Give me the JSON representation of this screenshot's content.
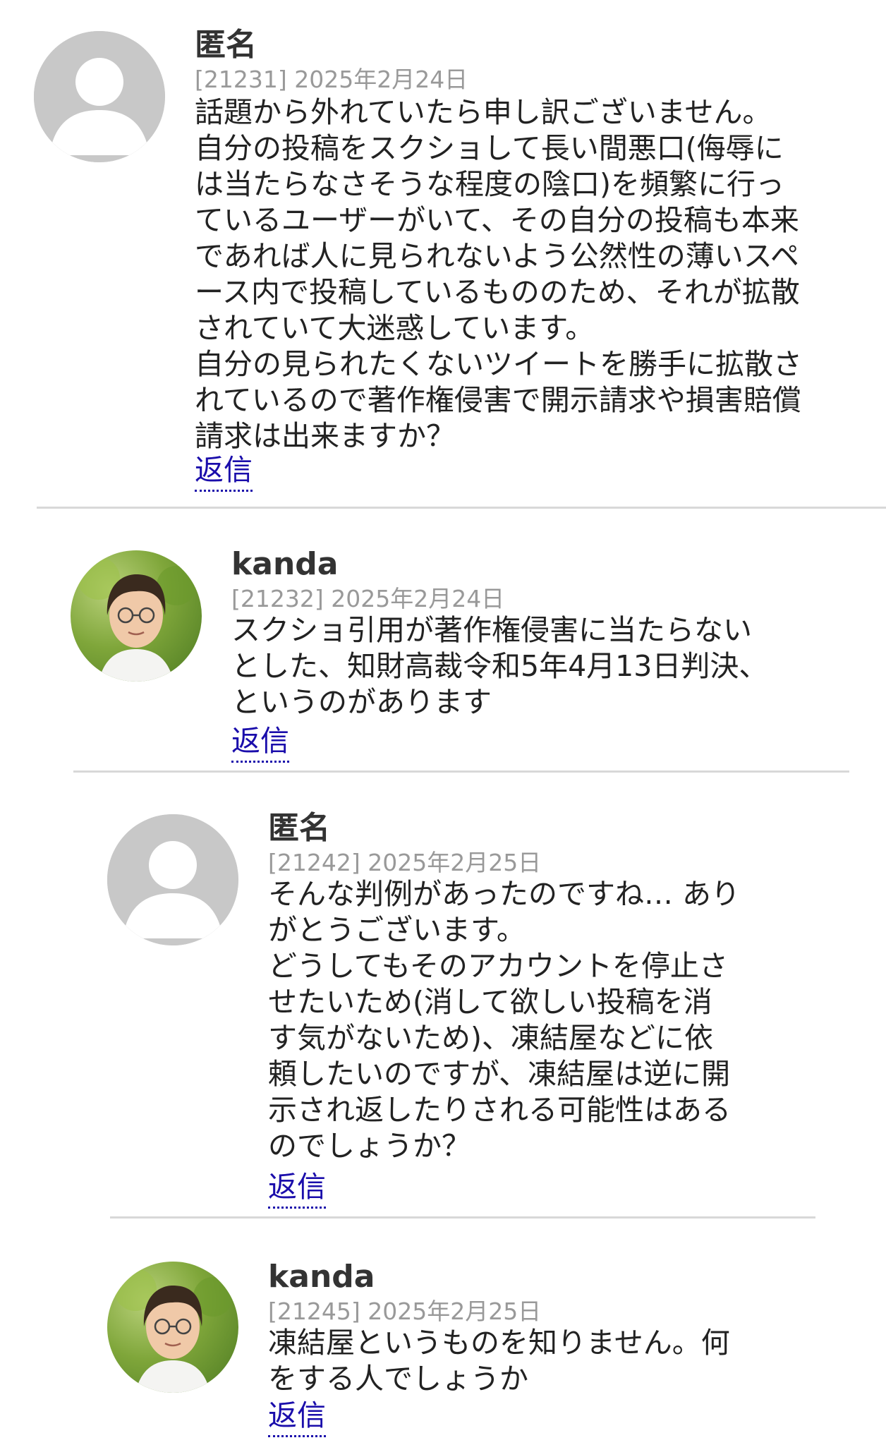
{
  "comments": [
    {
      "author": "匿名",
      "meta": "[21231] 2025年2月24日",
      "lines": [
        "話題から外れていたら申し訳ございません。",
        "自分の投稿をスクショして長い間悪口(侮辱に",
        "は当たらなさそうな程度の陰口)を頻繁に行っ",
        "ているユーザーがいて、その自分の投稿も本来",
        "であれば人に見られないよう公然性の薄いスペ",
        "ース内で投稿しているもののため、それが拡散",
        "されていて大迷惑しています。",
        "自分の見られたくないツイートを勝手に拡散さ",
        "れているので著作権侵害で開示請求や損害賠償",
        "請求は出来ますか？"
      ],
      "reply_label": "返信"
    },
    {
      "author": "kanda",
      "meta": "[21232] 2025年2月24日",
      "lines": [
        "スクショ引用が著作権侵害に当たらない",
        "とした、知財高裁令和5年4月13日判決、",
        "というのがあります"
      ],
      "reply_label": "返信"
    },
    {
      "author": "匿名",
      "meta": "[21242] 2025年2月25日",
      "lines": [
        "そんな判例があったのですね… あり",
        "がとうございます。",
        "どうしてもそのアカウントを停止さ",
        "せたいため(消して欲しい投稿を消",
        "す気がないため)、凍結屋などに依",
        "頼したいのですが、凍結屋は逆に開",
        "示され返したりされる可能性はある",
        "のでしょうか？"
      ],
      "reply_label": "返信"
    },
    {
      "author": "kanda",
      "meta": "[21245] 2025年2月25日",
      "lines": [
        "凍結屋というものを知りません。何",
        "をする人でしょうか"
      ],
      "reply_label": "返信"
    }
  ],
  "colors": {
    "link": "#1a0dab",
    "meta": "#999999",
    "avatar_placeholder": "#c8c8c8",
    "divider": "#d8d8d8"
  }
}
